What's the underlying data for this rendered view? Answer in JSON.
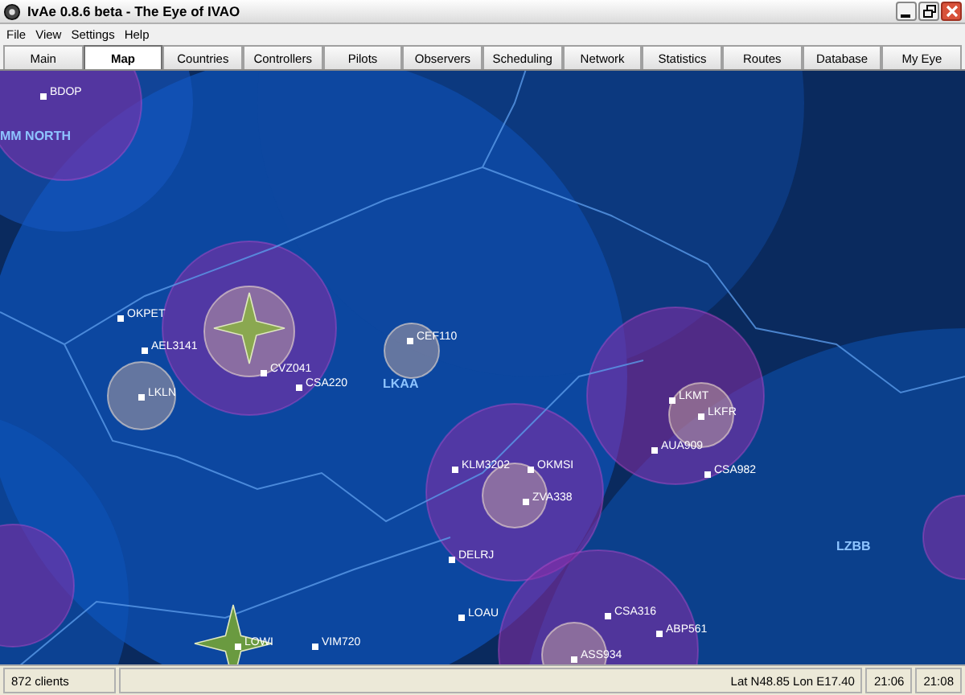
{
  "window": {
    "title": "IvAe 0.8.6 beta - The Eye of IVAO"
  },
  "menu": [
    "File",
    "View",
    "Settings",
    "Help"
  ],
  "tabs": [
    {
      "label": "Main",
      "selected": false
    },
    {
      "label": "Map",
      "selected": true
    },
    {
      "label": "Countries",
      "selected": false
    },
    {
      "label": "Controllers",
      "selected": false
    },
    {
      "label": "Pilots",
      "selected": false
    },
    {
      "label": "Observers",
      "selected": false
    },
    {
      "label": "Scheduling",
      "selected": false
    },
    {
      "label": "Network",
      "selected": false
    },
    {
      "label": "Statistics",
      "selected": false
    },
    {
      "label": "Routes",
      "selected": false
    },
    {
      "label": "Database",
      "selected": false
    },
    {
      "label": "My Eye",
      "selected": false
    }
  ],
  "map": {
    "markers": [
      {
        "kind": "station",
        "label": "BDOP"
      },
      {
        "kind": "sector",
        "label": "MM NORTH"
      },
      {
        "kind": "station",
        "label": "OKPET"
      },
      {
        "kind": "station",
        "label": "AEL3141"
      },
      {
        "kind": "station",
        "label": "CEF110"
      },
      {
        "kind": "station",
        "label": "CVZ041"
      },
      {
        "kind": "station",
        "label": "CSA220"
      },
      {
        "kind": "sector",
        "label": "LKAA"
      },
      {
        "kind": "station",
        "label": "LKLN"
      },
      {
        "kind": "station",
        "label": "LKMT"
      },
      {
        "kind": "station",
        "label": "LKFR"
      },
      {
        "kind": "station",
        "label": "AUA909"
      },
      {
        "kind": "station",
        "label": "KLM3202"
      },
      {
        "kind": "station",
        "label": "OKMSI"
      },
      {
        "kind": "station",
        "label": "CSA982"
      },
      {
        "kind": "station",
        "label": "ZVA338"
      },
      {
        "kind": "sector",
        "label": "LZBB"
      },
      {
        "kind": "station",
        "label": "DELRJ"
      },
      {
        "kind": "station",
        "label": "LOAU"
      },
      {
        "kind": "station",
        "label": "CSA316"
      },
      {
        "kind": "station",
        "label": "ABP561"
      },
      {
        "kind": "station",
        "label": "LOWI"
      },
      {
        "kind": "station",
        "label": "VIM720"
      },
      {
        "kind": "station",
        "label": "ASS934"
      }
    ]
  },
  "status_bar": {
    "clients": "872 clients",
    "position": "Lat N48.85 Lon E17.40",
    "time_1": "21:06",
    "time_2": "21:08"
  }
}
